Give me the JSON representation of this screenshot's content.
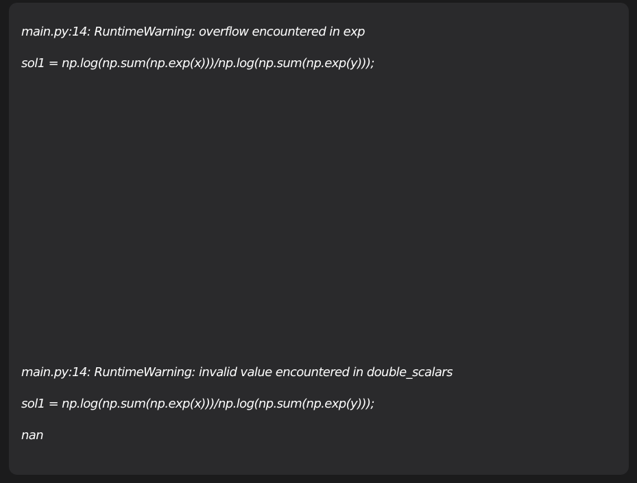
{
  "console": {
    "lines": [
      "main.py:14: RuntimeWarning: overflow encountered in exp",
      "sol1 = np.log(np.sum(np.exp(x)))/np.log(np.sum(np.exp(y)));",
      "main.py:14: RuntimeWarning: invalid value encountered in double_scalars",
      "sol1 = np.log(np.sum(np.exp(x)))/np.log(np.sum(np.exp(y)));",
      "nan"
    ]
  },
  "colors": {
    "page_background": "#1b1b1c",
    "panel_background": "#2a2a2c",
    "text": "#ffffff"
  }
}
